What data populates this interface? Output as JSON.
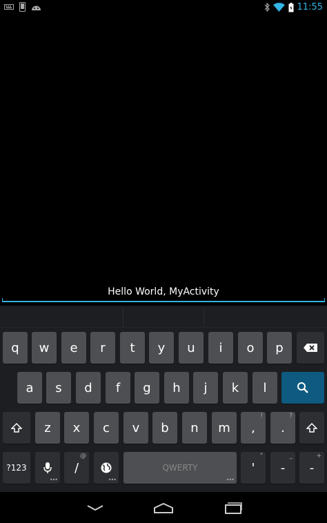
{
  "status_bar": {
    "left_icons": [
      "keyboard-icon",
      "phone-icon",
      "android-icon"
    ],
    "right_icons": [
      "bluetooth-icon",
      "wifi-icon",
      "battery-icon"
    ],
    "time": "11:55",
    "accent_color": "#33b5e5"
  },
  "input": {
    "value": "Hello World, MyActivity"
  },
  "keyboard": {
    "row1": [
      "q",
      "w",
      "e",
      "r",
      "t",
      "y",
      "u",
      "i",
      "o",
      "p"
    ],
    "row2": [
      "a",
      "s",
      "d",
      "f",
      "g",
      "h",
      "j",
      "k",
      "l"
    ],
    "row3": [
      "z",
      "x",
      "c",
      "v",
      "b",
      "n",
      "m"
    ],
    "row3_punct": [
      {
        "label": "!",
        "hint": "!"
      },
      {
        "label": ".",
        "hint": "?"
      }
    ],
    "row4": {
      "symbols_label": "?123",
      "slash_label": "/",
      "slash_hint": "@",
      "space_label": "QWERTY",
      "apostrophe_label": "'",
      "apostrophe_hint": "\"",
      "dash_label": "-",
      "dash_hint": "_",
      "dash2_label": "-",
      "dash2_hint": "+"
    },
    "icons": [
      "backspace-icon",
      "search-icon",
      "shift-icon",
      "mic-icon",
      "globe-icon"
    ],
    "search_key_color": "#0e5a80"
  },
  "nav_bar": {
    "icons": [
      "back-icon",
      "home-icon",
      "recents-icon"
    ]
  }
}
